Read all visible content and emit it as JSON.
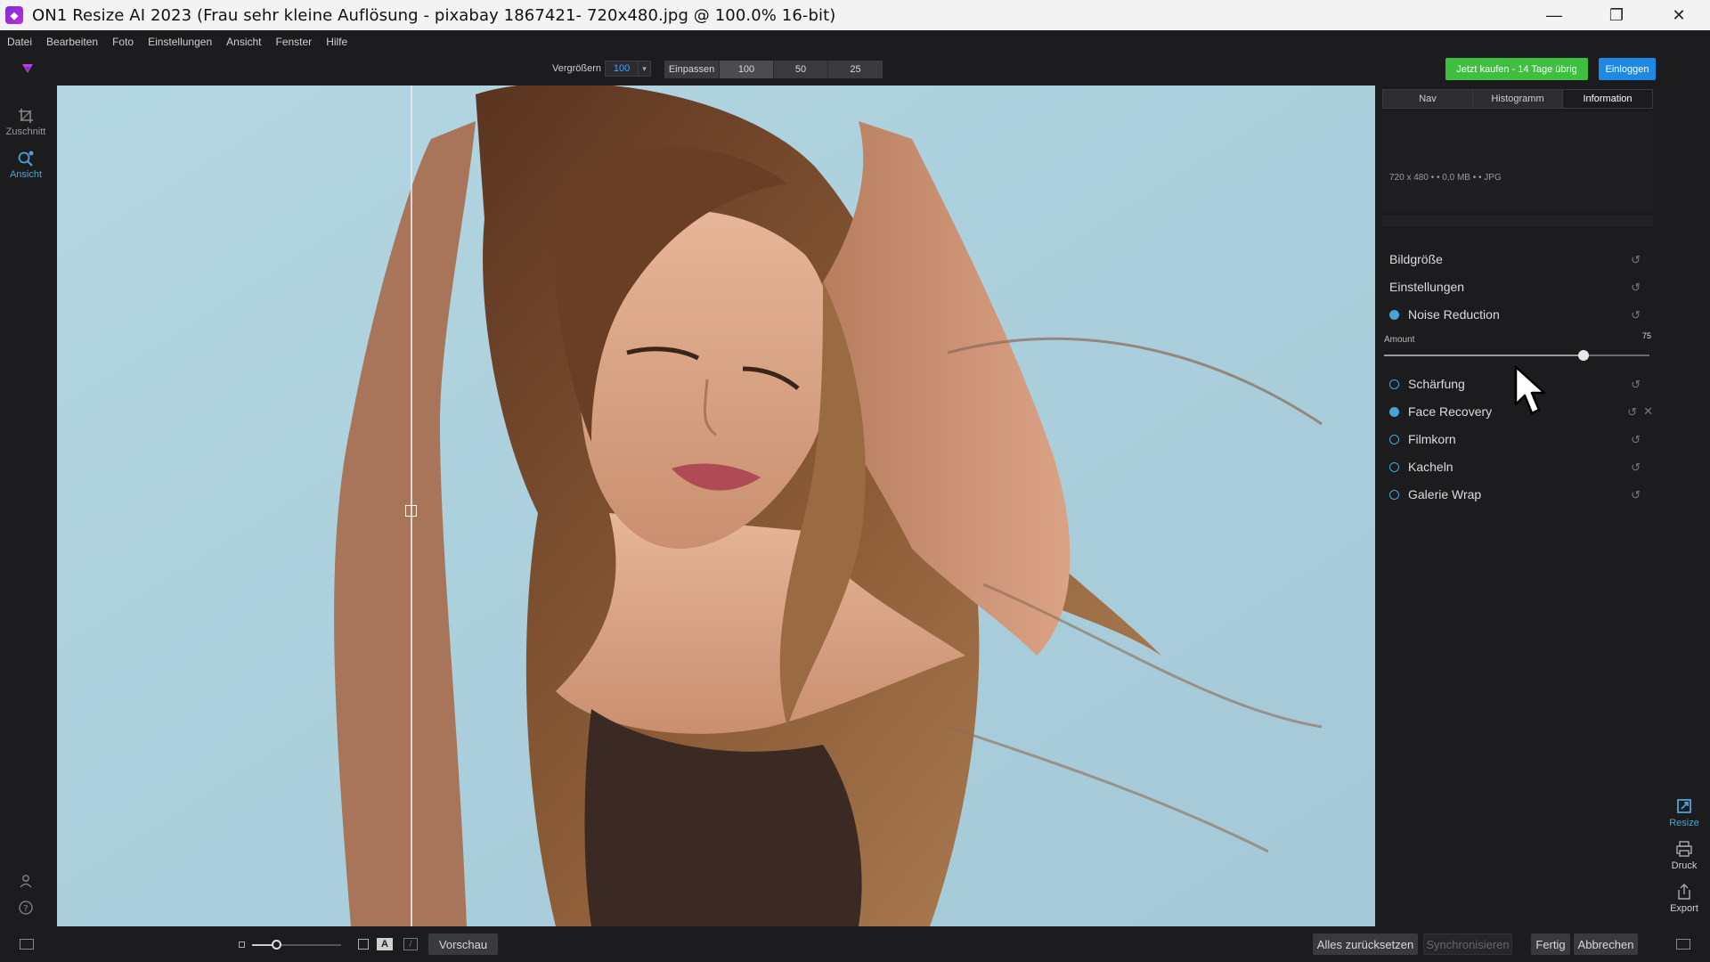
{
  "window": {
    "title": "ON1 Resize AI 2023 (Frau sehr kleine Auflösung - pixabay 1867421- 720x480.jpg @ 100.0% 16-bit)",
    "minimize": "—",
    "maximize": "❐",
    "close": "✕"
  },
  "menu": [
    "Datei",
    "Bearbeiten",
    "Foto",
    "Einstellungen",
    "Ansicht",
    "Fenster",
    "Hilfe"
  ],
  "toolbar": {
    "zoom_label": "Vergrößern",
    "zoom_value": "100",
    "segments": [
      "Einpassen",
      "100",
      "50",
      "25"
    ],
    "buy_label": "Jetzt kaufen - 14 Tage übrig",
    "login_label": "Einloggen"
  },
  "left_tools": [
    {
      "label": "Zuschnitt"
    },
    {
      "label": "Ansicht"
    }
  ],
  "right_panel": {
    "tabs": [
      "Nav",
      "Histogramm",
      "Information"
    ],
    "active_tab": "Information",
    "info_text": "720 x 480 • • 0,0 MB • • JPG",
    "sections": {
      "bildgroesse": "Bildgröße",
      "einstellungen": "Einstellungen",
      "noise_reduction": "Noise Reduction",
      "schaerfung": "Schärfung",
      "face_recovery": "Face Recovery",
      "filmkorn": "Filmkorn",
      "kacheln": "Kacheln",
      "galerie_wrap": "Galerie Wrap"
    },
    "amount_label": "Amount",
    "amount_value": "75",
    "amount_fraction": 0.75,
    "accent": "#4aa3d8"
  },
  "right_rail": [
    {
      "label": "Resize"
    },
    {
      "label": "Druck"
    },
    {
      "label": "Export"
    }
  ],
  "bottom": {
    "preview": "Vorschau",
    "reset_all": "Alles zurücksetzen",
    "sync": "Synchronisieren",
    "done": "Fertig",
    "cancel": "Abbrechen"
  }
}
